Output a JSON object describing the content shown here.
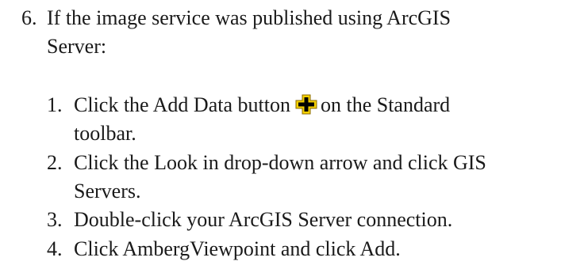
{
  "step": {
    "number": "6.",
    "text_line1": "If the image service was published using ArcGIS",
    "text_line2": "Server:"
  },
  "substeps": [
    {
      "number": "1.",
      "text_before_icon": "Click the Add Data button",
      "icon": "add-data-icon",
      "text_after_icon": "on the Standard",
      "text_line2": "toolbar."
    },
    {
      "number": "2.",
      "text_line1": "Click the Look in drop-down arrow and click GIS",
      "text_line2": "Servers."
    },
    {
      "number": "3.",
      "text_line1": "Double-click your ArcGIS Server connection."
    },
    {
      "number": "4.",
      "text_line1": "Click AmbergViewpoint and click Add."
    }
  ],
  "colors": {
    "text": "#1a1a1a",
    "icon_fill": "#f5d000",
    "icon_cross": "#000000"
  }
}
